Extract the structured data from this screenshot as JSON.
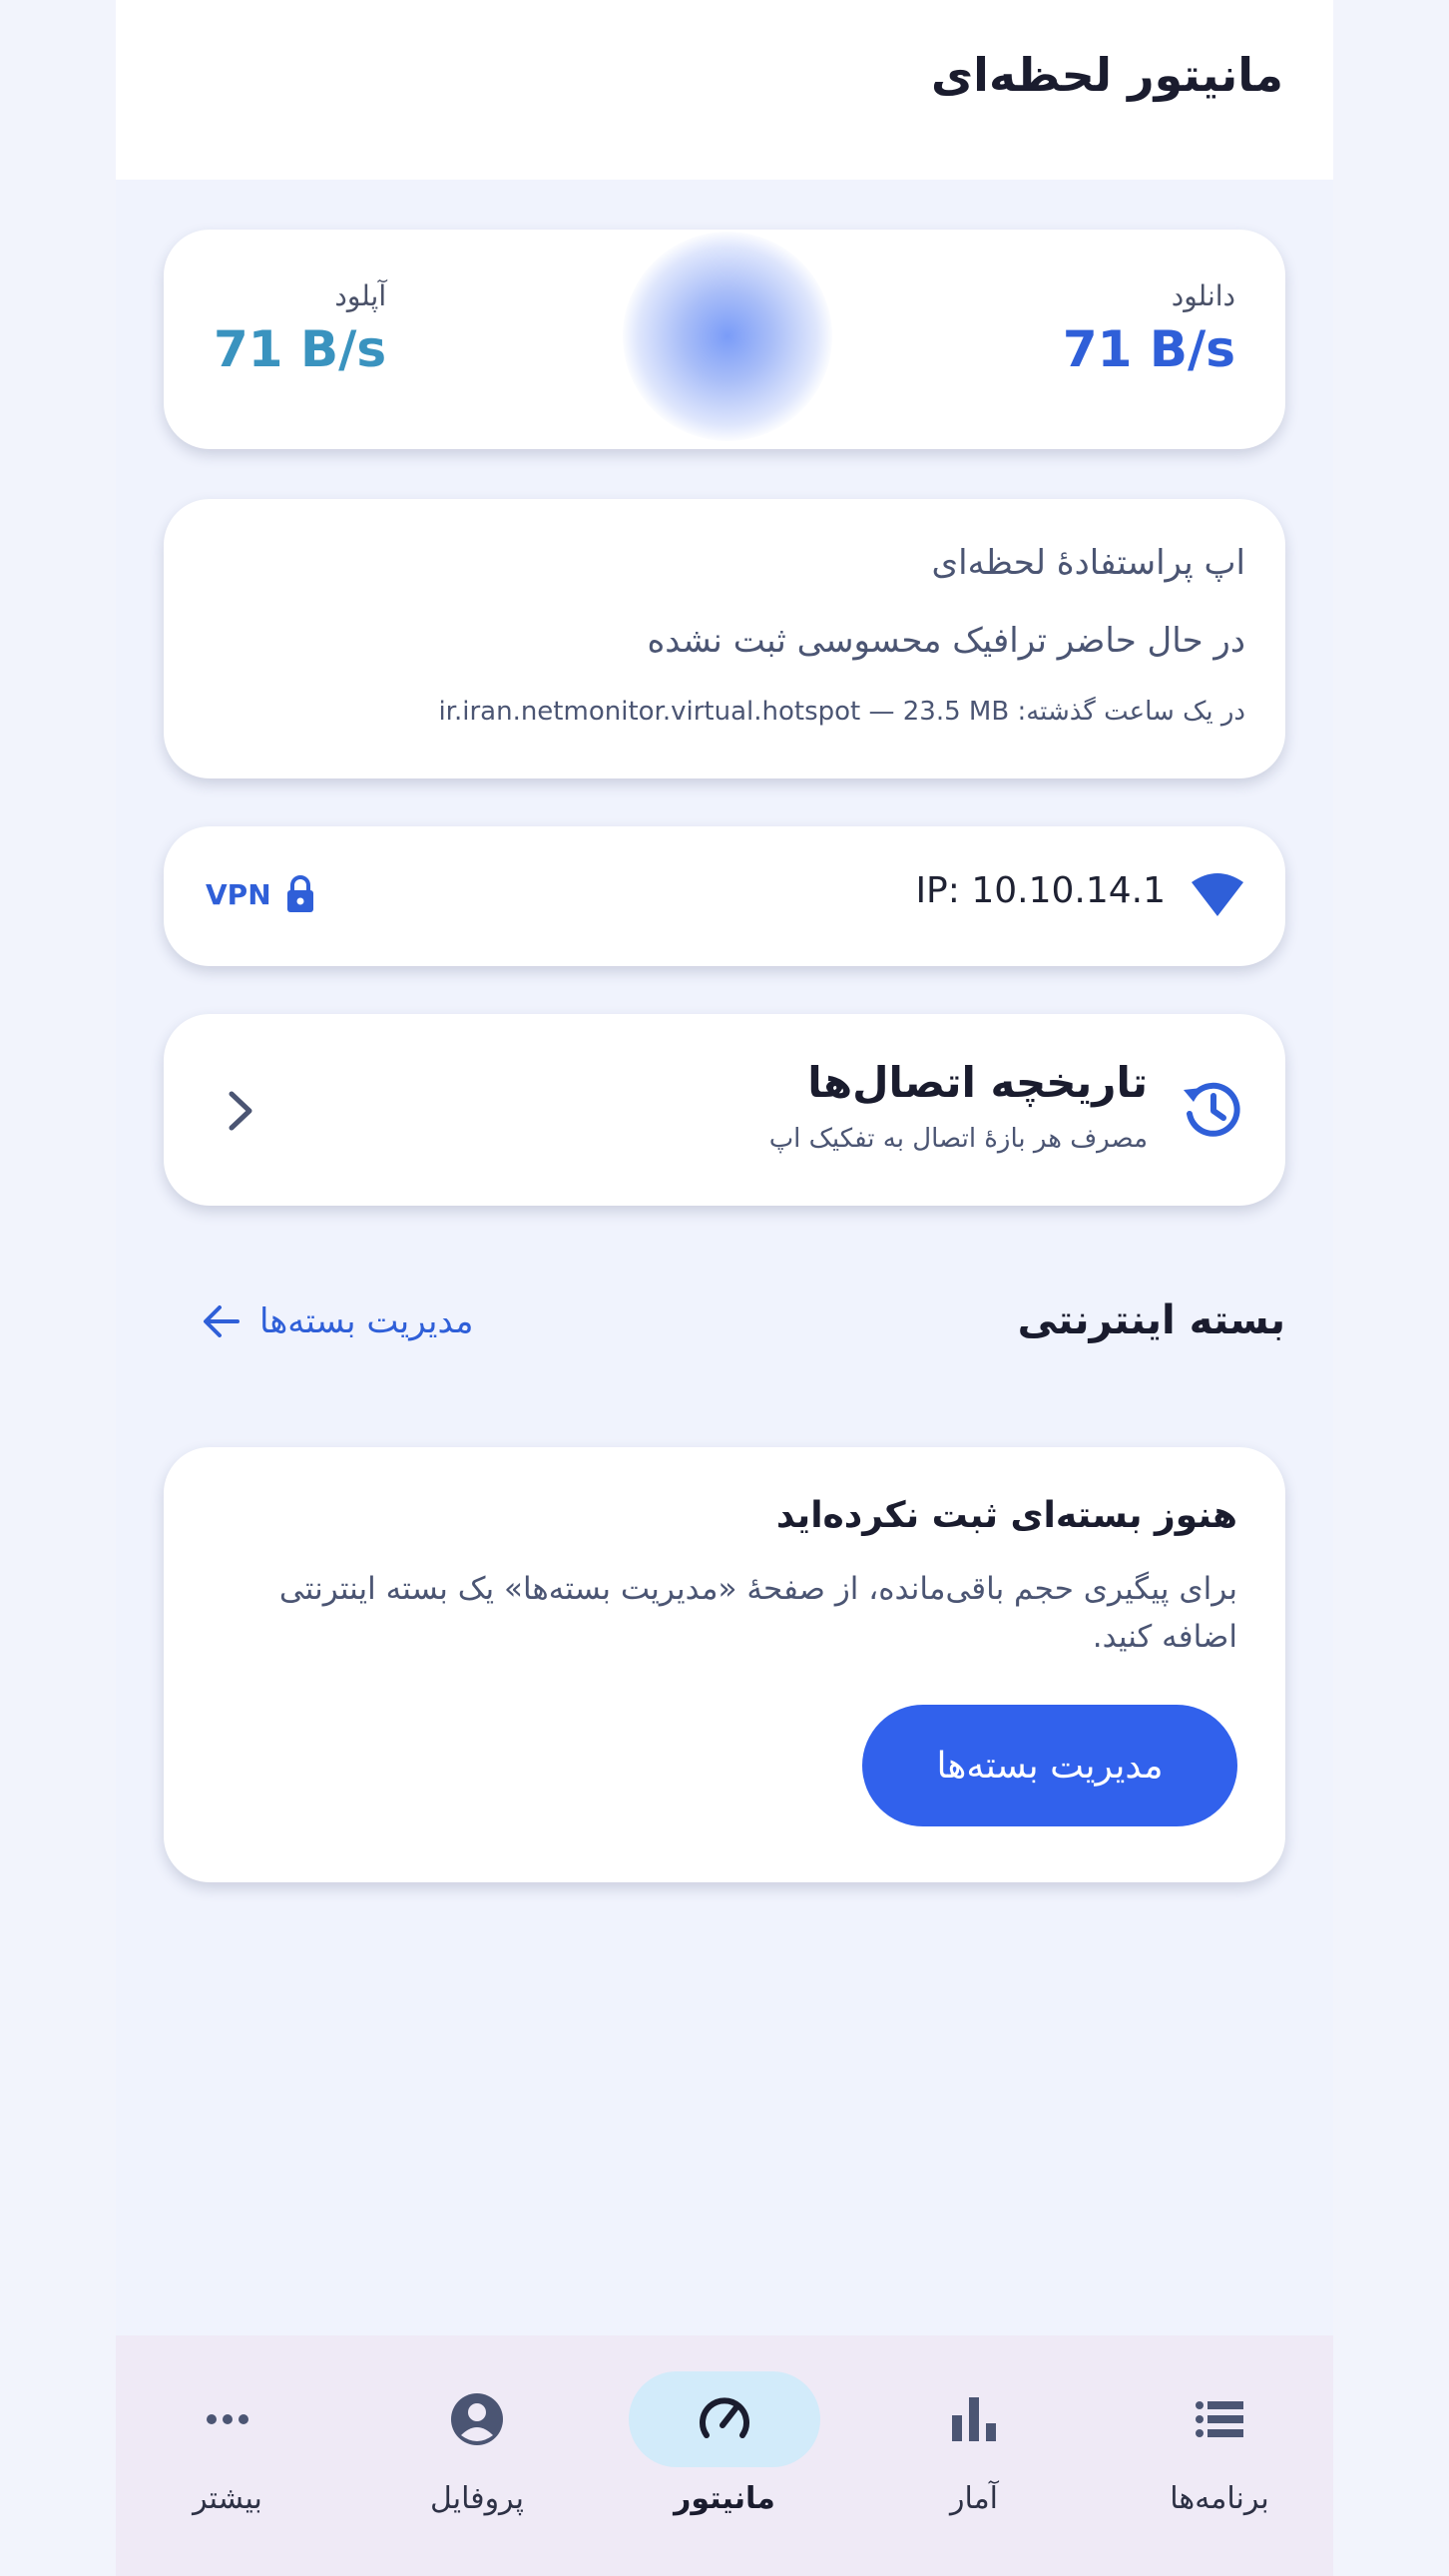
{
  "appbar": {
    "title": "مانیتور لحظه‌ای"
  },
  "speed": {
    "download_label": "دانلود",
    "download_value": "71 B/s",
    "upload_label": "آپلود",
    "upload_value": "71 B/s"
  },
  "instant_user": {
    "title": "اپ پراستفادهٔ لحظه‌ای",
    "status": "در حال حاضر ترافیک محسوسی ثبت نشده",
    "last_hour": "در یک ساعت گذشته: ir.iran.netmonitor.virtual.hotspot — 23.5 MB"
  },
  "network": {
    "ip": "IP: 10.10.14.1",
    "vpn_label": "VPN",
    "icons": [
      "wifi-icon",
      "lock-icon"
    ]
  },
  "history": {
    "title": "تاریخچه اتصال‌ها",
    "subtitle": "مصرف هر بازهٔ اتصال به تفکیک اپ"
  },
  "packages_section": {
    "title": "بسته اینترنتی",
    "manage_link": "مدیریت بسته‌ها"
  },
  "empty_packages": {
    "title": "هنوز بسته‌ای ثبت نکرده‌اید",
    "body": "برای پیگیری حجم باقی‌مانده، از صفحهٔ «مدیریت بسته‌ها» یک بسته اینترنتی اضافه کنید.",
    "button": "مدیریت بسته‌ها"
  },
  "bottom_nav": {
    "items": [
      {
        "label": "برنامه‌ها",
        "icon": "list-icon",
        "active": false
      },
      {
        "label": "آمار",
        "icon": "bar-chart-icon",
        "active": false
      },
      {
        "label": "مانیتور",
        "icon": "speedometer-icon",
        "active": true
      },
      {
        "label": "پروفایل",
        "icon": "profile-icon",
        "active": false
      },
      {
        "label": "بیشتر",
        "icon": "more-icon",
        "active": false
      }
    ]
  },
  "colors": {
    "accent": "#3161ec",
    "download": "#2f5fd8",
    "upload": "#3a93bf",
    "nav_active_pill": "#d2ebfa"
  }
}
